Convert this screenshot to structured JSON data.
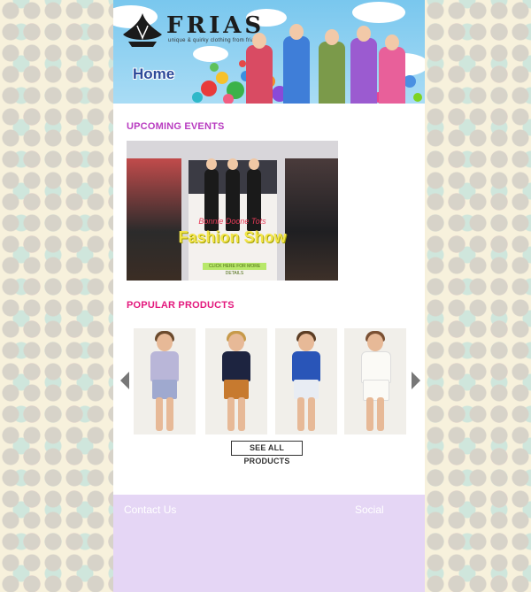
{
  "header": {
    "brand": "FRIAS",
    "tagline": "unique & quirky clothing from frias",
    "nav_home": "Home"
  },
  "events": {
    "title": "UPCOMING EVENTS",
    "card": {
      "subtitle": "Bonnie Doone Tots",
      "headline": "Fashion Show",
      "cta": "CLICK HERE FOR MORE DETAILS"
    }
  },
  "products": {
    "title": "POPULAR PRODUCTS",
    "see_all": "SEE ALL PRODUCTS",
    "items": [
      {
        "name": "product-1",
        "top": "#b9b6d8",
        "bottom": "#9fa9cf",
        "hair": "#6b4a2d"
      },
      {
        "name": "product-2",
        "top": "#1d2440",
        "bottom": "#c77a2f",
        "hair": "#c79a4a"
      },
      {
        "name": "product-3",
        "top": "#2955b8",
        "bottom": "#e8ecf3",
        "hair": "#5c3d24"
      },
      {
        "name": "product-4",
        "top": "#f4f3ef",
        "bottom": "#f4f3ef",
        "hair": "#7a5033"
      }
    ]
  },
  "footer": {
    "contact": "Contact Us",
    "social": "Social"
  },
  "colors": {
    "events_title": "#b83cc0",
    "products_title": "#e3187d",
    "footer_bg": "#e5d6f5"
  }
}
